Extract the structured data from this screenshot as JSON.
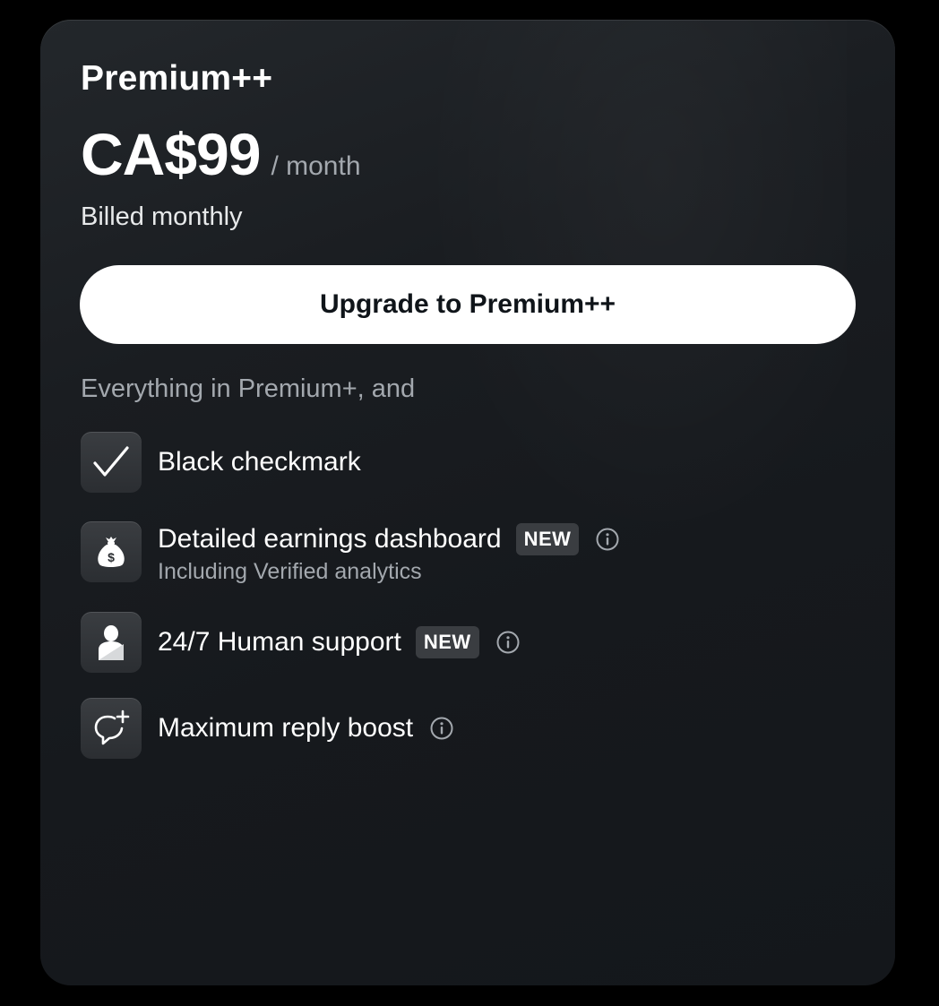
{
  "plan": {
    "name": "Premium++",
    "price": "CA$99",
    "period": "/ month",
    "billing": "Billed monthly",
    "cta_label": "Upgrade to Premium++",
    "intro": "Everything in Premium+, and"
  },
  "features": [
    {
      "icon": "checkmark-icon",
      "title": "Black checkmark",
      "badge": "",
      "subtitle": "",
      "info": false
    },
    {
      "icon": "money-bag-icon",
      "title": "Detailed earnings dashboard",
      "badge": "NEW",
      "subtitle": "Including Verified analytics",
      "info": true
    },
    {
      "icon": "person-icon",
      "title": "24/7 Human support",
      "badge": "NEW",
      "subtitle": "",
      "info": true
    },
    {
      "icon": "reply-boost-icon",
      "title": "Maximum reply boost",
      "badge": "",
      "subtitle": "",
      "info": true
    }
  ],
  "colors": {
    "card_background": "#1a1d21",
    "primary_text": "#ffffff",
    "secondary_text": "#a3a8ae",
    "button_background": "#ffffff",
    "button_text": "#0f1419",
    "badge_background": "#3a3d41"
  }
}
